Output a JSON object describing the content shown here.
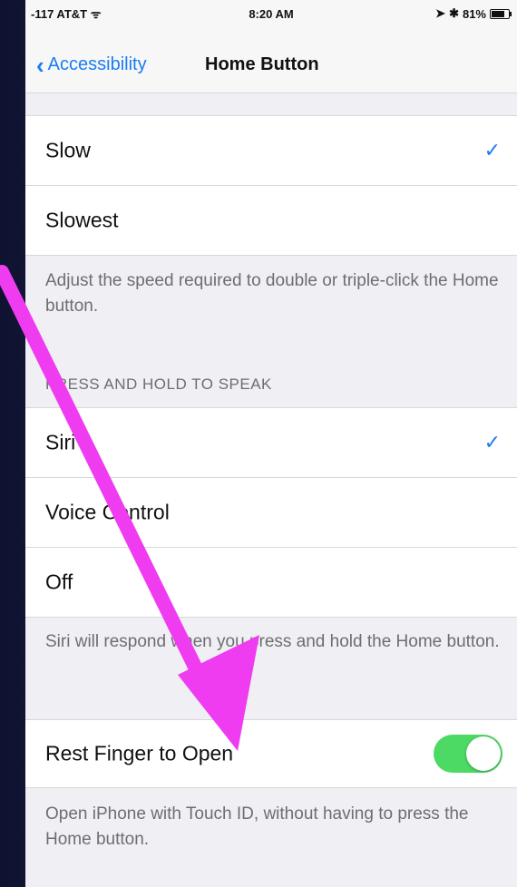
{
  "status_bar": {
    "carrier": "-117 AT&T",
    "time": "8:20 AM",
    "battery": "81%"
  },
  "nav": {
    "back_label": "Accessibility",
    "title": "Home Button"
  },
  "speed_group": {
    "items": [
      {
        "label": "Slow",
        "checked": true
      },
      {
        "label": "Slowest",
        "checked": false
      }
    ],
    "footer": "Adjust the speed required to double or triple-click the Home button."
  },
  "speak_group": {
    "header": "PRESS AND HOLD TO SPEAK",
    "items": [
      {
        "label": "Siri",
        "checked": true
      },
      {
        "label": "Voice Control",
        "checked": false
      },
      {
        "label": "Off",
        "checked": false
      }
    ],
    "footer": "Siri will respond when you press and hold the Home button."
  },
  "rest_finger": {
    "label": "Rest Finger to Open",
    "enabled": true,
    "footer": "Open iPhone with Touch ID, without having to press the Home button."
  },
  "colors": {
    "accent": "#1a7cf2",
    "toggle_on": "#4cd964",
    "annotation_arrow": "#f03cf0"
  }
}
